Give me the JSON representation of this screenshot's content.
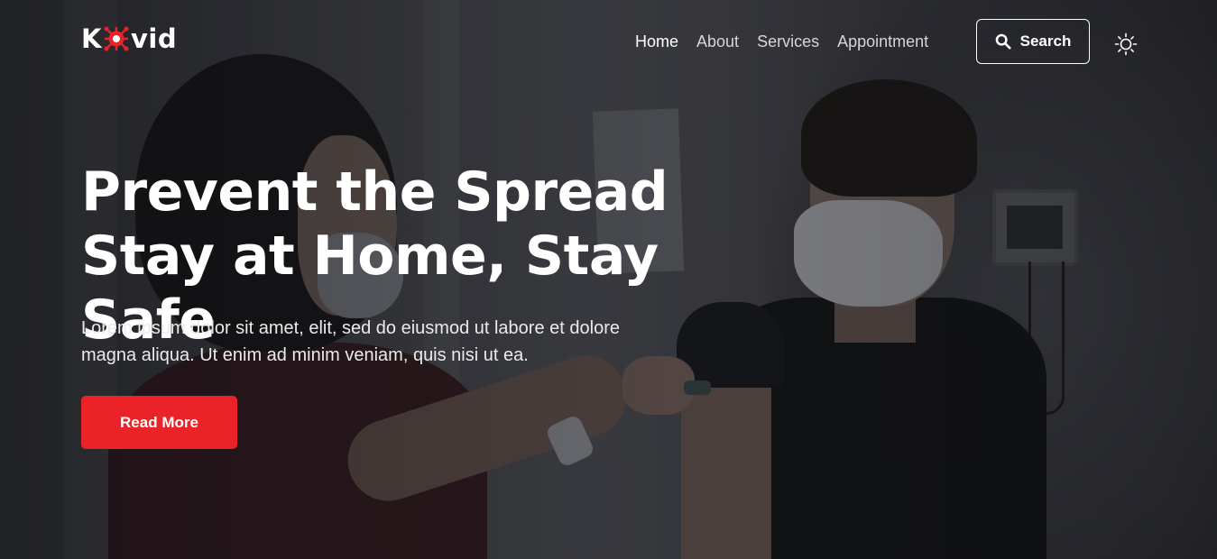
{
  "brand": {
    "name_prefix": "K",
    "name_suffix": "vid",
    "logo_icon": "virus-icon",
    "accent_color": "#eb2227"
  },
  "nav": {
    "items": [
      {
        "label": "Home",
        "active": true
      },
      {
        "label": "About",
        "active": false
      },
      {
        "label": "Services",
        "active": false
      },
      {
        "label": "Appointment",
        "active": false
      }
    ]
  },
  "search": {
    "label": "Search",
    "icon": "search-icon"
  },
  "theme_toggle": {
    "icon": "sun-icon"
  },
  "hero": {
    "title": "Prevent the Spread Stay at Home, Stay Safe",
    "description": "Lorem ipsum dolor sit amet, elit, sed do eiusmod ut labore et dolore magna aliqua. Ut enim ad minim veniam, quis nisi ut ea.",
    "cta_label": "Read More"
  }
}
